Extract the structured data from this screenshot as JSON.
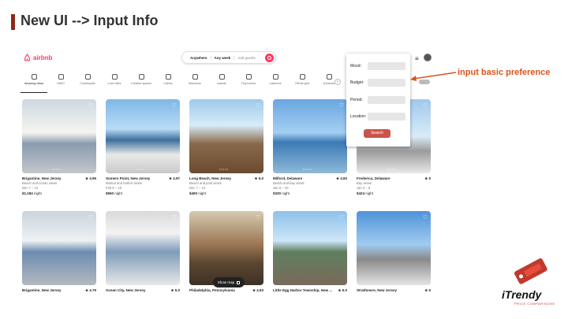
{
  "slide": {
    "title": "New UI --> Input Info"
  },
  "annotation": {
    "text": "input basic preference",
    "color": "#d9541e"
  },
  "header": {
    "logo_text": "airbnb",
    "search": {
      "anywhere": "Anywhere",
      "any_week": "Any week",
      "guests": "Add guests"
    }
  },
  "categories": [
    "Amazing views",
    "OMG!",
    "Countryside",
    "Luxe cities",
    "Creative spaces",
    "Cabins",
    "Mansions",
    "Islands",
    "Tiny homes",
    "Lakefront",
    "Off-the-grid",
    "A-frames"
  ],
  "popup": {
    "mood_label": "Mood:",
    "budget_label": "Budget:",
    "period_label": "Period:",
    "location_label": "Location:",
    "search_label": "Search"
  },
  "listings_row1": [
    {
      "title": "Brigantine, New Jersey",
      "rating": "★ 4.95",
      "sub": "Beach and ocean views",
      "dates": "Dec 7 – 12",
      "price": "$1,184",
      "unit": "night"
    },
    {
      "title": "Somers Point, New Jersey",
      "rating": "★ 4.97",
      "sub": "Marina and harbor views",
      "dates": "Feb 5 – 10",
      "price": "$560",
      "unit": "night"
    },
    {
      "title": "Long Beach, New Jersey",
      "rating": "★ 5.0",
      "sub": "Beach and pool views",
      "dates": "Dec 7 – 14",
      "price": "$400",
      "unit": "night"
    },
    {
      "title": "Milford, Delaware",
      "rating": "★ 4.83",
      "sub": "Beach and bay views",
      "dates": "Jan 5 – 10",
      "price": "$330",
      "unit": "night"
    },
    {
      "title": "Frederica, Delaware",
      "rating": "★ 5",
      "sub": "Bay views",
      "dates": "Jan 3 – 8",
      "price": "$424",
      "unit": "night"
    }
  ],
  "listings_row2": [
    {
      "title": "Brigantine, New Jersey",
      "rating": "★ 4.79"
    },
    {
      "title": "Ocean City, New Jersey",
      "rating": "★ 5.0"
    },
    {
      "title": "Philadelphia, Pennsylvania",
      "rating": "★ 4.93"
    },
    {
      "title": "Little Egg Harbor Township, New ...",
      "rating": "★ 5.0"
    },
    {
      "title": "Strathmere, New Jersey",
      "rating": "★ 5"
    }
  ],
  "show_map": "Show map",
  "brand": {
    "name": "iTrendy",
    "tagline": "PRICE COMPARISONS"
  }
}
